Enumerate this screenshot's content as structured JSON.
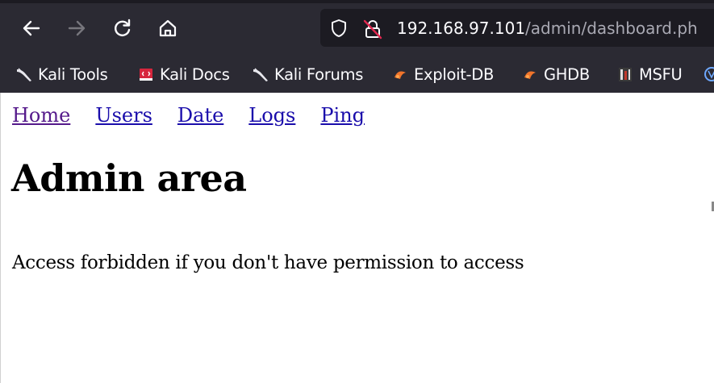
{
  "browser": {
    "url_host": "192.168.97.101",
    "url_path": "/admin/dashboard.ph",
    "icons": [
      "back-arrow-icon",
      "forward-arrow-icon",
      "reload-icon",
      "home-icon",
      "shield-icon",
      "insecure-lock-icon"
    ]
  },
  "bookmarks": [
    {
      "label": "Kali Tools",
      "icon": "kali-dragon-icon"
    },
    {
      "label": "Kali Docs",
      "icon": "kali-docs-icon"
    },
    {
      "label": "Kali Forums",
      "icon": "kali-dragon-icon"
    },
    {
      "label": "Exploit-DB",
      "icon": "exploit-db-icon"
    },
    {
      "label": "GHDB",
      "icon": "ghdb-icon"
    },
    {
      "label": "MSFU",
      "icon": "msfu-icon"
    }
  ],
  "page": {
    "nav": [
      "Home",
      "Users",
      "Date",
      "Logs",
      "Ping"
    ],
    "heading": "Admin area",
    "message": "Access forbidden if you don't have permission to access"
  },
  "colors": {
    "toolbar": "#2b2a33",
    "urlbar": "#1c1b22",
    "link": "#1a0dab",
    "visited_link": "#551a8b",
    "insecure": "#e22850"
  }
}
